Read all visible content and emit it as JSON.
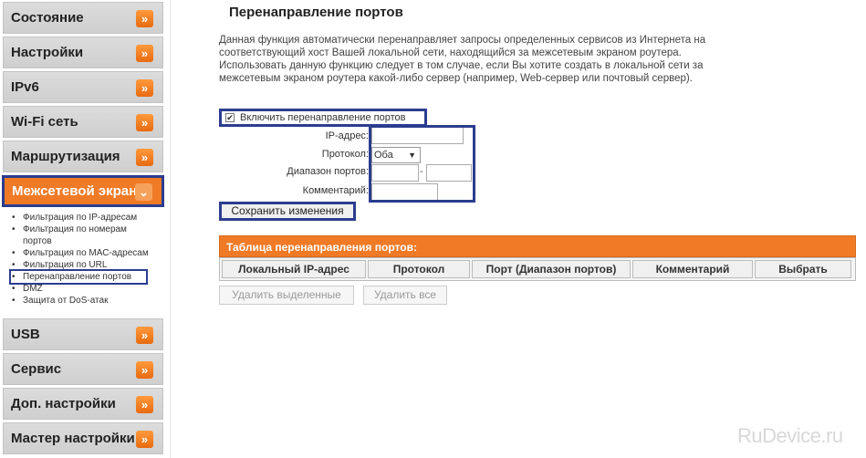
{
  "sidebar": {
    "items": [
      {
        "label": "Состояние"
      },
      {
        "label": "Настройки"
      },
      {
        "label": "IPv6"
      },
      {
        "label": "Wi-Fi сеть"
      },
      {
        "label": "Маршрутизация"
      },
      {
        "label": "Межсетевой экран"
      },
      {
        "label": "USB"
      },
      {
        "label": "Сервис"
      },
      {
        "label": "Доп. настройки"
      },
      {
        "label": "Мастер настройки"
      }
    ],
    "arrow_glyph": "»",
    "active_arrow_glyph": "⌄",
    "submenu": [
      "Фильтрация по IP-адресам",
      "Фильтрация по номерам портов",
      "Фильтрация по МАС-адресам",
      "Фильтрация по URL",
      "Перенаправление портов",
      "DMZ",
      "Защита от DoS-атак"
    ]
  },
  "main": {
    "title": "Перенаправление портов",
    "description": "Данная функция автоматически перенаправляет запросы определенных сервисов из Интернета на соответствующий хост Вашей локальной сети, находящийся за межсетевым экраном роутера. Использовать данную функцию следует в том случае, если Вы хотите создать в локальной сети за межсетевым экраном роутера какой-либо сервер (например, Web-сервер или почтовый сервер).",
    "enable_checkbox": {
      "label": "Включить перенаправление портов",
      "checked": true,
      "mark": "✔"
    },
    "form": {
      "ip_label": "IP-адрес:",
      "ip_value": "",
      "protocol_label": "Протокол:",
      "protocol_value": "Оба",
      "port_range_label": "Диапазон портов:",
      "port_from": "",
      "port_separator": "-",
      "port_to": "",
      "comment_label": "Комментарий:",
      "comment_value": ""
    },
    "save_label": "Сохранить изменения",
    "table": {
      "title": "Таблица перенаправления портов:",
      "columns": [
        "Локальный IP-адрес",
        "Протокол",
        "Порт (Диапазон портов)",
        "Комментарий",
        "Выбрать"
      ]
    },
    "delete_selected_label": "Удалить выделенные",
    "delete_all_label": "Удалить все"
  },
  "watermark": "RuDevice.ru",
  "colors": {
    "accent": "#f07a26",
    "highlight_box": "#2b3d8f"
  }
}
